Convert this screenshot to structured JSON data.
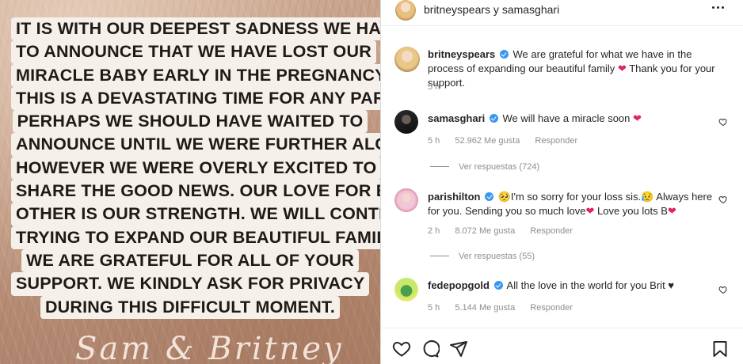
{
  "post": {
    "statement_lines": [
      "It is with our deepest sadness we have",
      "to announce that we have lost our",
      "miracle baby early in the pregnancy.",
      "This is a devastating time for any parent.",
      "Perhaps we should have waited to",
      "announce until we were further along",
      "however we were overly excited to",
      "share the good news. Our love for each",
      "other is our strength. We will continue",
      "trying to expand our beautiful family.",
      "We are grateful for all of your",
      "support.  We kindly ask for privacy",
      "during this difficult moment."
    ],
    "signature": "Sam & Britney"
  },
  "header": {
    "title": "britneyspears y samasghari",
    "more_icon": "more-horizontal-icon"
  },
  "caption": {
    "username": "britneyspears",
    "text_before": "We are grateful for what we have in the process of expanding our beautiful family",
    "emoji": "❤",
    "text_after": "Thank you for your support.",
    "time": "5 h"
  },
  "comments": [
    {
      "username": "samasghari",
      "text": "We will have a miracle soon",
      "emoji": "❤",
      "time": "5 h",
      "likes": "52.962 Me gusta",
      "reply_label": "Responder",
      "view_replies": "Ver respuestas (724)"
    },
    {
      "username": "parishilton",
      "emoji_before": "🥺",
      "text": "I'm so sorry for your loss sis.",
      "text_mid": "Always here for you. Sending you so much love",
      "text_end": "Love you lots B",
      "emoji_mid": "😥",
      "emoji_heart": "❤",
      "time": "2 h",
      "likes": "8.072 Me gusta",
      "reply_label": "Responder",
      "view_replies": "Ver respuestas (55)"
    },
    {
      "username": "fedepopgold",
      "text": "All the love in the world for you Brit ♥",
      "time": "5 h",
      "likes": "5.144 Me gusta",
      "reply_label": "Responder"
    }
  ],
  "icons": {
    "like": "heart-outline-icon",
    "comment": "comment-icon",
    "share": "send-icon",
    "save": "bookmark-icon"
  },
  "colors": {
    "verified": "#3897f0",
    "heart": "#e0245e",
    "muted": "#8e8e8e"
  }
}
